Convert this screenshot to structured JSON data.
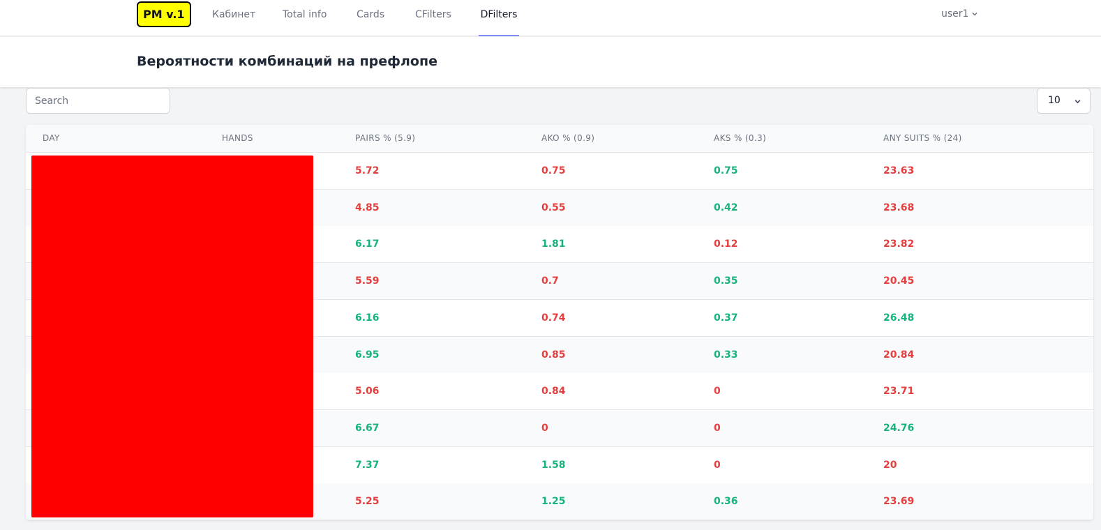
{
  "nav": {
    "logo": "PM v.1",
    "links": [
      "Кабинет",
      "Total info",
      "Cards",
      "CFilters",
      "DFilters"
    ],
    "active": "DFilters",
    "user": "user1"
  },
  "header": {
    "title": "Вероятности комбинаций на префлопе"
  },
  "controls": {
    "search_placeholder": "Search",
    "per_page": "10"
  },
  "table": {
    "columns": [
      "DAY",
      "HANDS",
      "PAIRS % (5.9)",
      "AKO % (0.9)",
      "AKS % (0.3)",
      "ANY SUITS % (24)"
    ],
    "rows": [
      {
        "pairs": "5.72",
        "pairs_c": "red",
        "ako": "0.75",
        "ako_c": "red",
        "aks": "0.75",
        "aks_c": "green",
        "any": "23.63",
        "any_c": "red"
      },
      {
        "pairs": "4.85",
        "pairs_c": "red",
        "ako": "0.55",
        "ako_c": "red",
        "aks": "0.42",
        "aks_c": "green",
        "any": "23.68",
        "any_c": "red"
      },
      {
        "pairs": "6.17",
        "pairs_c": "green",
        "ako": "1.81",
        "ako_c": "green",
        "aks": "0.12",
        "aks_c": "red",
        "any": "23.82",
        "any_c": "red"
      },
      {
        "pairs": "5.59",
        "pairs_c": "red",
        "ako": "0.7",
        "ako_c": "red",
        "aks": "0.35",
        "aks_c": "green",
        "any": "20.45",
        "any_c": "red"
      },
      {
        "pairs": "6.16",
        "pairs_c": "green",
        "ako": "0.74",
        "ako_c": "red",
        "aks": "0.37",
        "aks_c": "green",
        "any": "26.48",
        "any_c": "green"
      },
      {
        "pairs": "6.95",
        "pairs_c": "green",
        "ako": "0.85",
        "ako_c": "red",
        "aks": "0.33",
        "aks_c": "green",
        "any": "20.84",
        "any_c": "red"
      },
      {
        "pairs": "5.06",
        "pairs_c": "red",
        "ako": "0.84",
        "ako_c": "red",
        "aks": "0",
        "aks_c": "red",
        "any": "23.71",
        "any_c": "red"
      },
      {
        "pairs": "6.67",
        "pairs_c": "green",
        "ako": "0",
        "ako_c": "red",
        "aks": "0",
        "aks_c": "red",
        "any": "24.76",
        "any_c": "green"
      },
      {
        "pairs": "7.37",
        "pairs_c": "green",
        "ako": "1.58",
        "ako_c": "green",
        "aks": "0",
        "aks_c": "red",
        "any": "20",
        "any_c": "red"
      },
      {
        "pairs": "5.25",
        "pairs_c": "red",
        "ako": "1.25",
        "ako_c": "green",
        "aks": "0.36",
        "aks_c": "green",
        "any": "23.69",
        "any_c": "red"
      }
    ]
  },
  "colors": {
    "positive": "#16b37e",
    "negative": "#e53e3e",
    "logo_bg": "#ffff00",
    "redaction": "#ff0000"
  }
}
